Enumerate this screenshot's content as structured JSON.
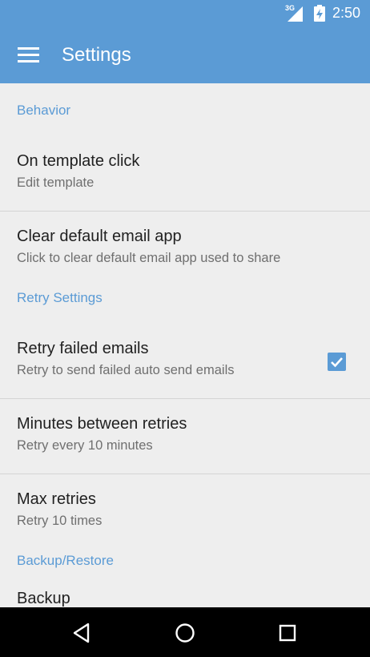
{
  "status_bar": {
    "network": "3G",
    "time": "2:50"
  },
  "app_bar": {
    "title": "Settings"
  },
  "sections": {
    "behavior": {
      "header": "Behavior",
      "template_click": {
        "title": "On template click",
        "summary": "Edit template"
      },
      "clear_email": {
        "title": "Clear default email app",
        "summary": "Click to clear default email app used to share"
      }
    },
    "retry": {
      "header": "Retry Settings",
      "retry_failed": {
        "title": "Retry failed emails",
        "summary": "Retry to send failed auto send emails",
        "checked": true
      },
      "minutes": {
        "title": "Minutes between retries",
        "summary": "Retry every 10 minutes"
      },
      "max": {
        "title": "Max retries",
        "summary": "Retry 10 times"
      }
    },
    "backup": {
      "header": "Backup/Restore",
      "backup_item": {
        "title": "Backup"
      }
    }
  },
  "colors": {
    "accent": "#5b9bd5",
    "background": "#eeeeee",
    "navbar": "#000000"
  }
}
